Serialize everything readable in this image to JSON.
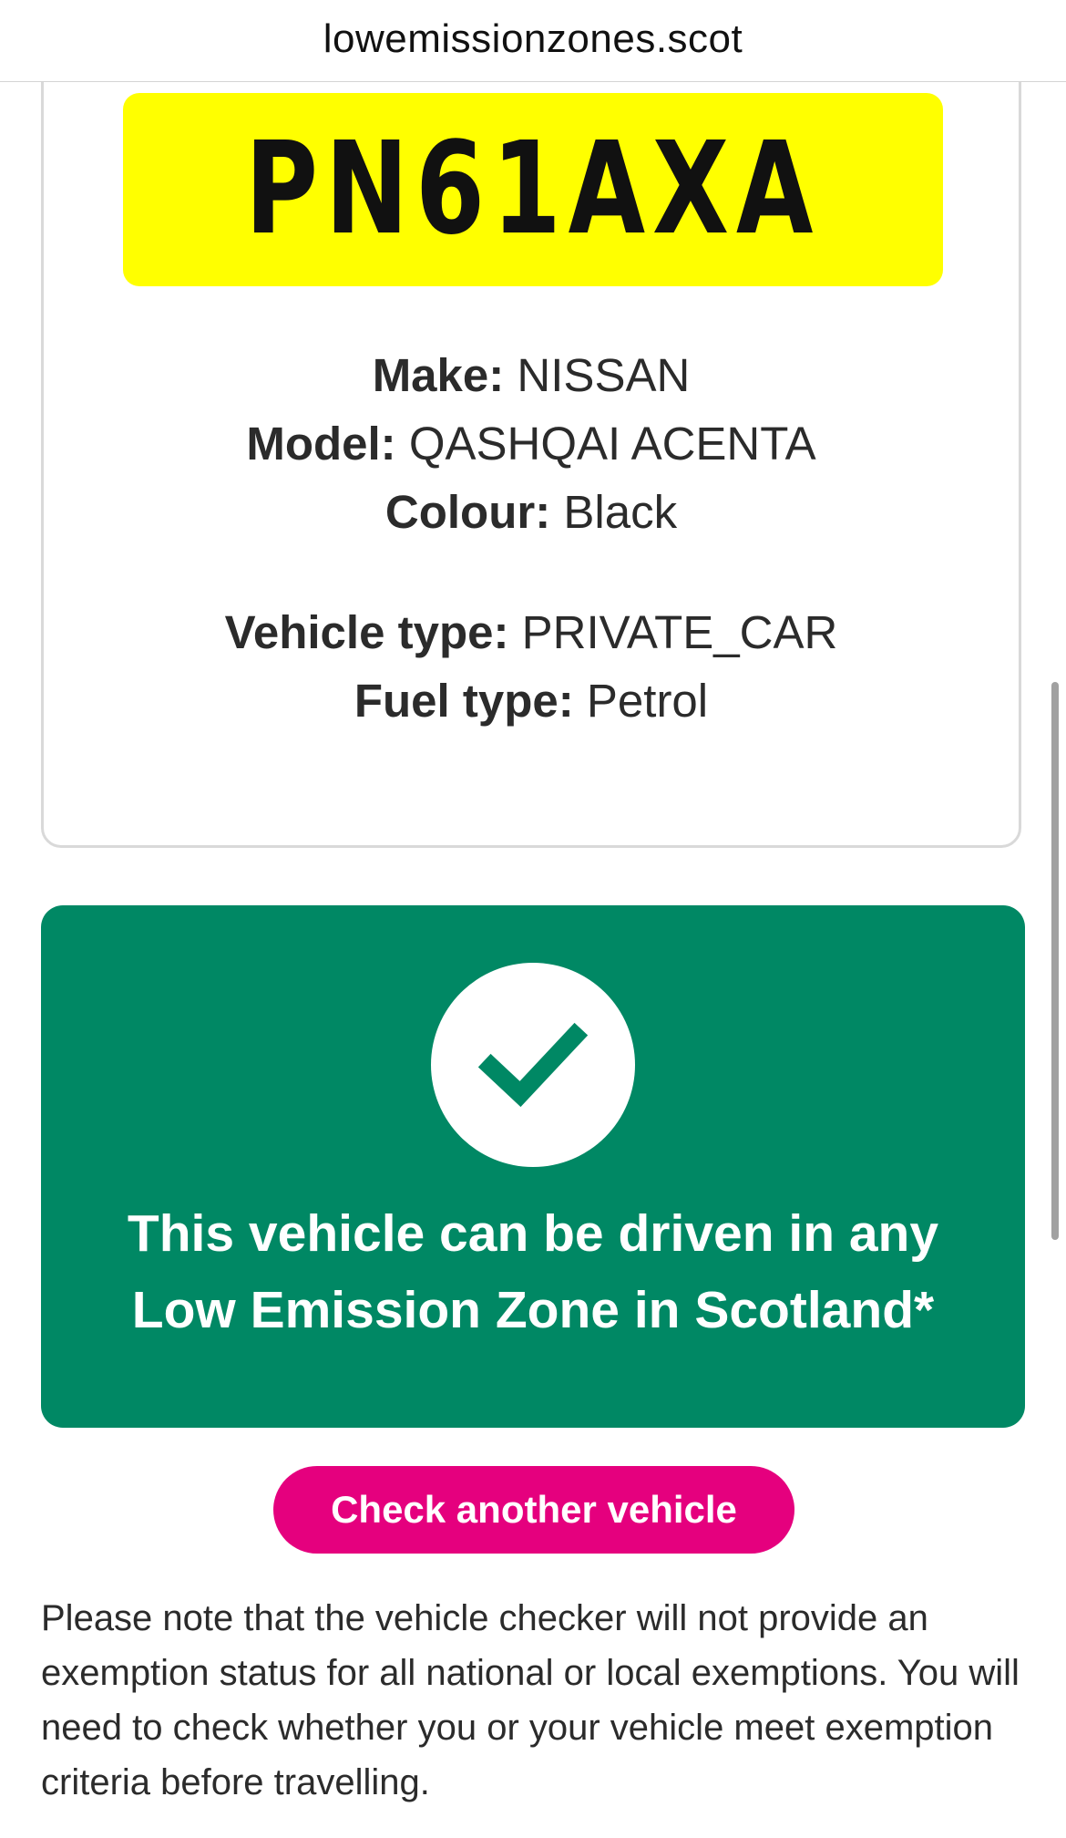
{
  "browser": {
    "url": "lowemissionzones.scot"
  },
  "vehicle": {
    "registration": "PN61AXA",
    "make_label": "Make:",
    "make_value": "NISSAN",
    "model_label": "Model:",
    "model_value": "QASHQAI ACENTA",
    "colour_label": "Colour:",
    "colour_value": "Black",
    "vehicle_type_label": "Vehicle type:",
    "vehicle_type_value": "PRIVATE_CAR",
    "fuel_type_label": "Fuel type:",
    "fuel_type_value": "Petrol"
  },
  "result": {
    "icon": "check-icon",
    "line1": "This vehicle can be driven in any",
    "line2": "Low Emission Zone in Scotland*",
    "color": "#008864"
  },
  "actions": {
    "check_another_label": "Check another vehicle",
    "button_color": "#e5007e"
  },
  "note": {
    "text": "Please note that the vehicle checker will not provide an exemption status for all national or local exemptions. You will need to check whether you or your vehicle meet exemption criteria before travelling."
  },
  "plate_color": "#ffff00"
}
